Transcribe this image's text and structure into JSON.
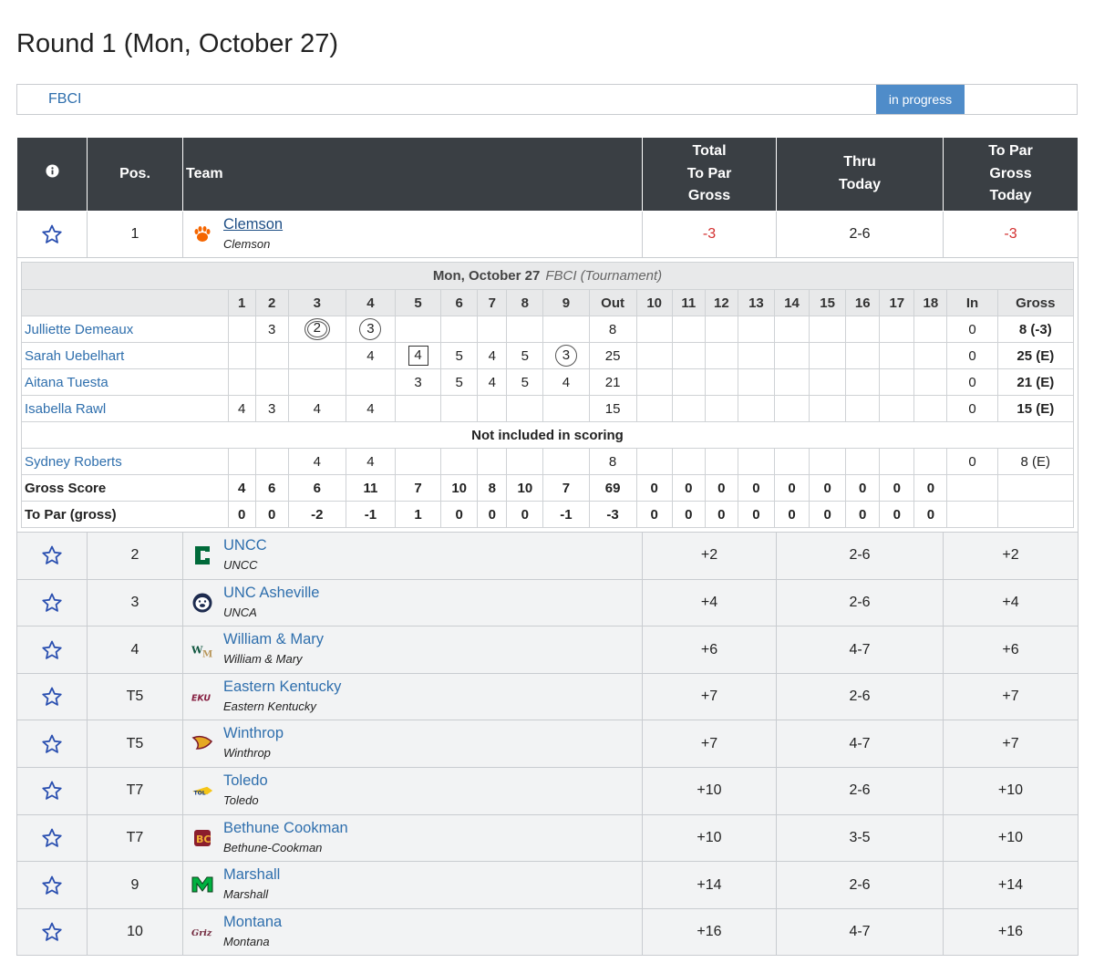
{
  "page": {
    "title": "Round 1 (Mon, October 27)"
  },
  "course_bar": {
    "course": "FBCI",
    "status": "in progress"
  },
  "colors": {
    "header_bg": "#3a3f44",
    "link": "#2f6fad",
    "status_bg": "#4f8cc9",
    "under_par": "#d32f2f",
    "star": "#2a4fb0"
  },
  "table": {
    "headers": {
      "info_icon": "info-circle-icon",
      "pos": "Pos.",
      "team": "Team",
      "total_1": "Total",
      "total_2": "To Par",
      "total_3": "Gross",
      "thru_1": "Thru",
      "thru_2": "Today",
      "topar_1": "To Par",
      "topar_2": "Gross",
      "topar_3": "Today"
    },
    "leader": {
      "pos": "1",
      "name": "Clemson",
      "sub": "Clemson",
      "total": "-3",
      "thru": "2-6",
      "today": "-3",
      "logo": "tiger-paw-icon"
    },
    "rows": [
      {
        "pos": "2",
        "name": "UNCC",
        "sub": "UNCC",
        "total": "+2",
        "thru": "2-6",
        "today": "+2",
        "logo": "uncc-logo-icon"
      },
      {
        "pos": "3",
        "name": "UNC Asheville",
        "sub": "UNCA",
        "total": "+4",
        "thru": "2-6",
        "today": "+4",
        "logo": "bulldog-logo-icon"
      },
      {
        "pos": "4",
        "name": "William & Mary",
        "sub": "William & Mary",
        "total": "+6",
        "thru": "4-7",
        "today": "+6",
        "logo": "wm-logo-icon"
      },
      {
        "pos": "T5",
        "name": "Eastern Kentucky",
        "sub": "Eastern Kentucky",
        "total": "+7",
        "thru": "2-6",
        "today": "+7",
        "logo": "eku-logo-icon"
      },
      {
        "pos": "T5",
        "name": "Winthrop",
        "sub": "Winthrop",
        "total": "+7",
        "thru": "4-7",
        "today": "+7",
        "logo": "eagle-logo-icon"
      },
      {
        "pos": "T7",
        "name": "Toledo",
        "sub": "Toledo",
        "total": "+10",
        "thru": "2-6",
        "today": "+10",
        "logo": "rockets-logo-icon"
      },
      {
        "pos": "T7",
        "name": "Bethune Cookman",
        "sub": "Bethune-Cookman",
        "total": "+10",
        "thru": "3-5",
        "today": "+10",
        "logo": "bc-logo-icon"
      },
      {
        "pos": "9",
        "name": "Marshall",
        "sub": "Marshall",
        "total": "+14",
        "thru": "2-6",
        "today": "+14",
        "logo": "m-logo-icon"
      },
      {
        "pos": "10",
        "name": "Montana",
        "sub": "Montana",
        "total": "+16",
        "thru": "4-7",
        "today": "+16",
        "logo": "griz-logo-icon"
      }
    ]
  },
  "scorecard": {
    "date": "Mon, October 27",
    "event": "FBCI (Tournament)",
    "holes": [
      "1",
      "2",
      "3",
      "4",
      "5",
      "6",
      "7",
      "8",
      "9",
      "Out",
      "10",
      "11",
      "12",
      "13",
      "14",
      "15",
      "16",
      "17",
      "18",
      "In",
      "Gross"
    ],
    "players": [
      {
        "name": "Julliette Demeaux",
        "scores": [
          "",
          "3",
          "2",
          "3",
          "",
          "",
          "",
          "",
          "",
          "8",
          "",
          "",
          "",
          "",
          "",
          "",
          "",
          "",
          "",
          "0",
          "8 (-3)"
        ],
        "marks": {
          "2": "dcirc",
          "3": "circ"
        },
        "gross_bold": true
      },
      {
        "name": "Sarah Uebelhart",
        "scores": [
          "",
          "",
          "",
          "4",
          "4",
          "5",
          "4",
          "5",
          "3",
          "25",
          "",
          "",
          "",
          "",
          "",
          "",
          "",
          "",
          "",
          "0",
          "25 (E)"
        ],
        "marks": {
          "4": "sq",
          "8": "circ"
        },
        "gross_bold": true
      },
      {
        "name": "Aitana Tuesta",
        "scores": [
          "",
          "",
          "",
          "",
          "3",
          "5",
          "4",
          "5",
          "4",
          "21",
          "",
          "",
          "",
          "",
          "",
          "",
          "",
          "",
          "",
          "0",
          "21 (E)"
        ],
        "marks": {},
        "gross_bold": true
      },
      {
        "name": "Isabella Rawl",
        "scores": [
          "4",
          "3",
          "4",
          "4",
          "",
          "",
          "",
          "",
          "",
          "15",
          "",
          "",
          "",
          "",
          "",
          "",
          "",
          "",
          "",
          "0",
          "15 (E)"
        ],
        "marks": {},
        "gross_bold": true
      }
    ],
    "not_included_label": "Not included in scoring",
    "extra_players": [
      {
        "name": "Sydney Roberts",
        "scores": [
          "",
          "",
          "4",
          "4",
          "",
          "",
          "",
          "",
          "",
          "8",
          "",
          "",
          "",
          "",
          "",
          "",
          "",
          "",
          "",
          "0",
          "8 (E)"
        ],
        "marks": {},
        "gross_bold": false
      }
    ],
    "totals": [
      {
        "label": "Gross Score",
        "values": [
          "4",
          "6",
          "6",
          "11",
          "7",
          "10",
          "8",
          "10",
          "7",
          "69",
          "0",
          "0",
          "0",
          "0",
          "0",
          "0",
          "0",
          "0",
          "0",
          "",
          ""
        ]
      },
      {
        "label": "To Par (gross)",
        "values": [
          "0",
          "0",
          "-2",
          "-1",
          "1",
          "0",
          "0",
          "0",
          "-1",
          "-3",
          "0",
          "0",
          "0",
          "0",
          "0",
          "0",
          "0",
          "0",
          "0",
          "",
          ""
        ]
      }
    ]
  }
}
